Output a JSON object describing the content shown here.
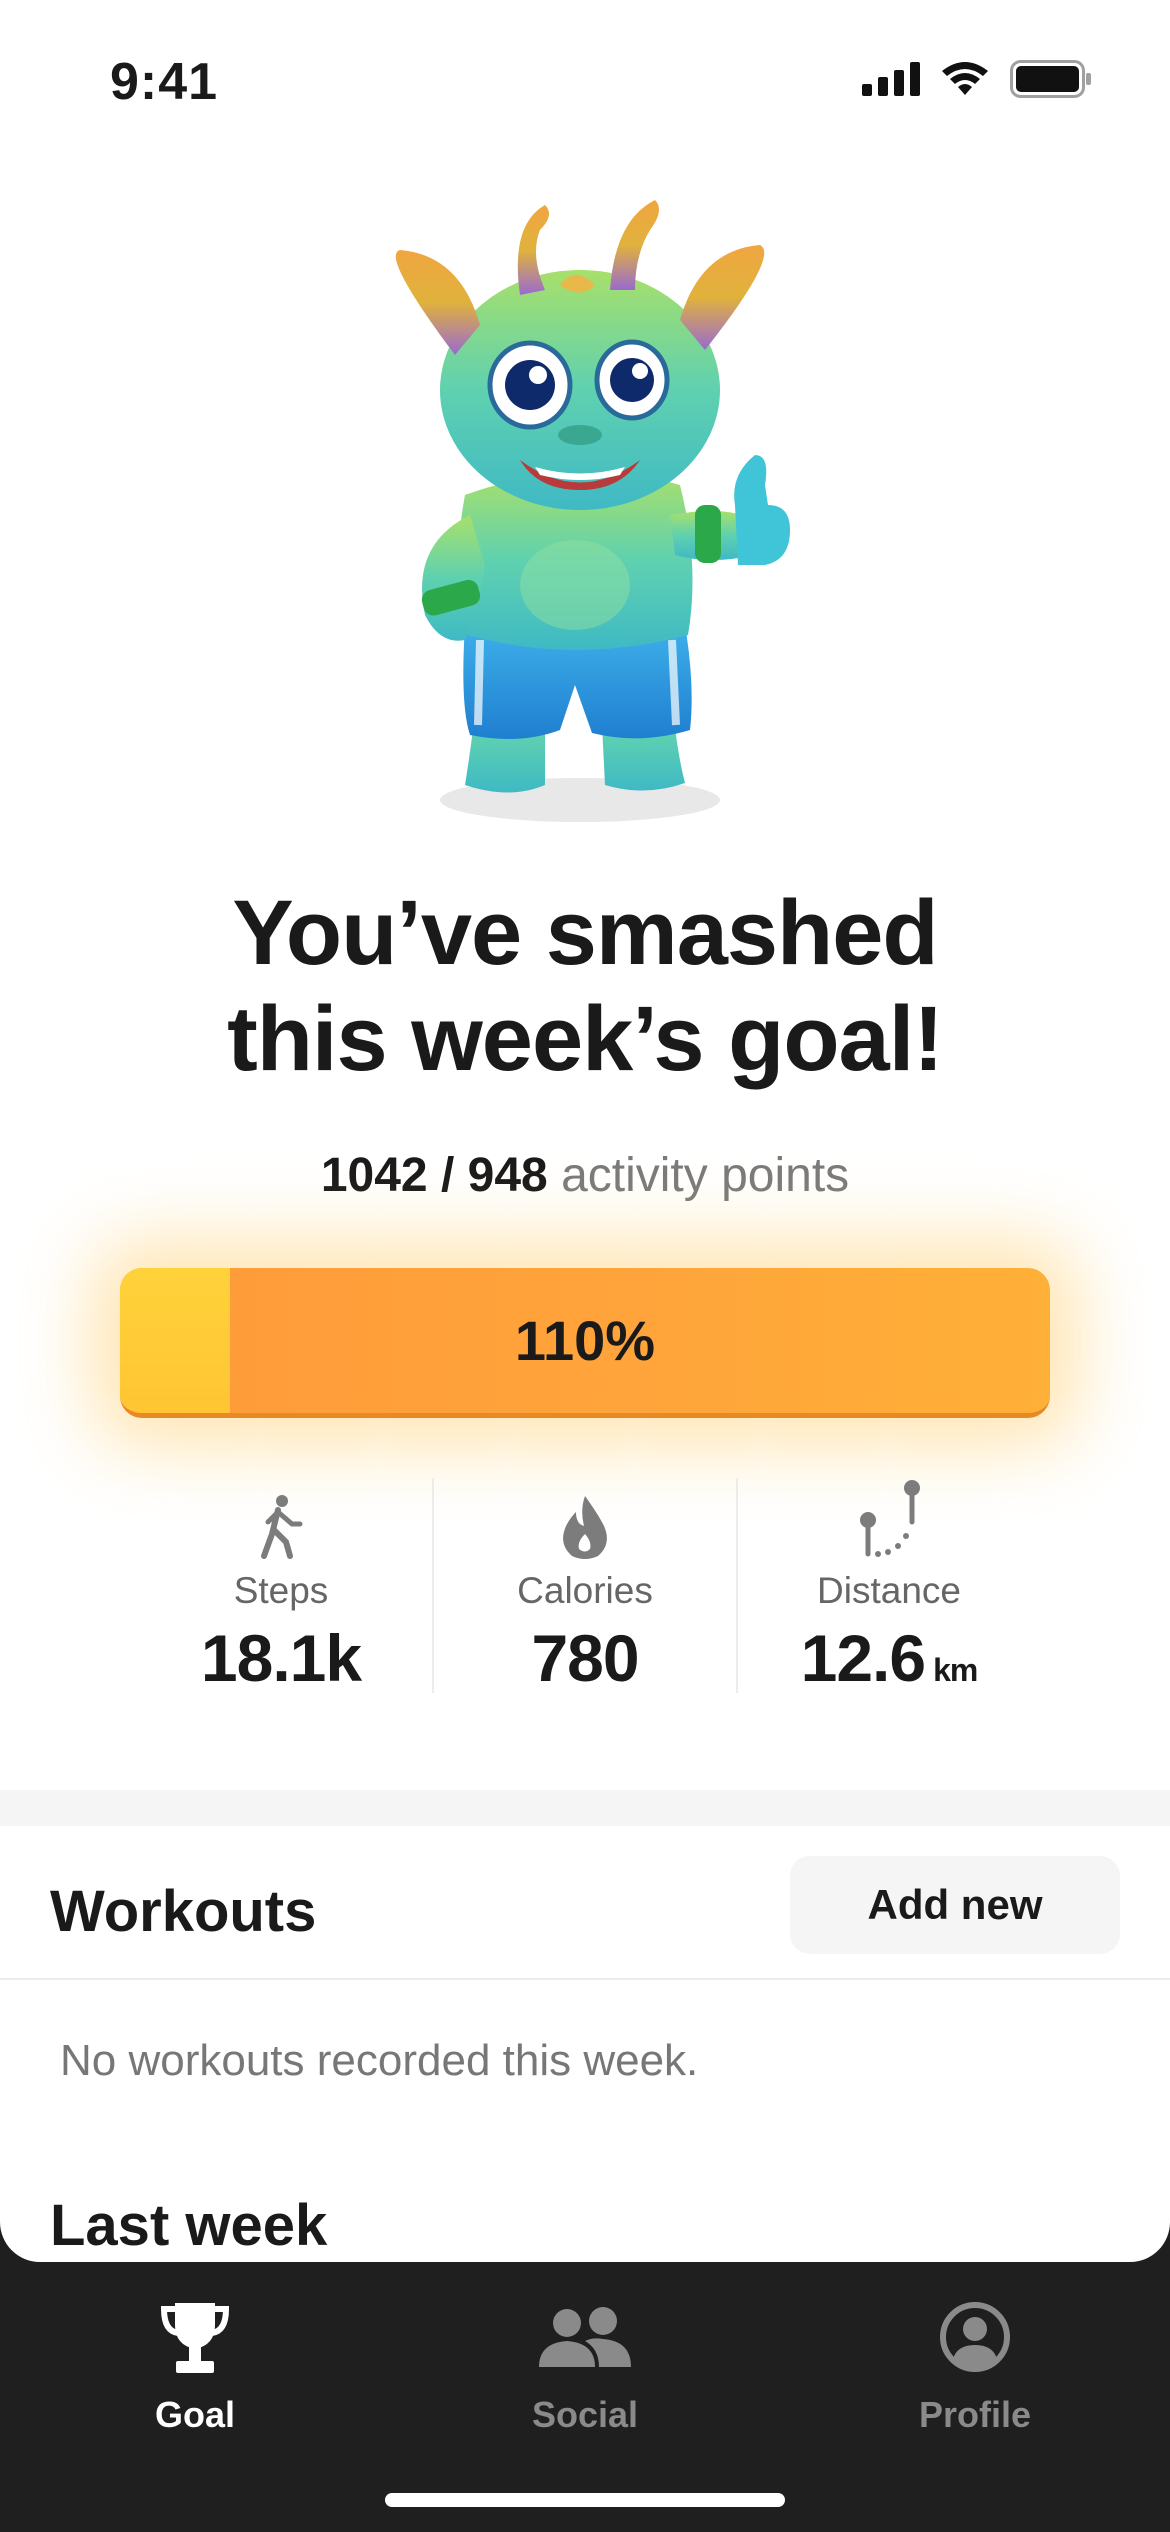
{
  "status_bar": {
    "time": "9:41"
  },
  "hero": {
    "headline_line1": "You’ve smashed",
    "headline_line2": "this week’s goal!"
  },
  "activity": {
    "current_points": "1042",
    "separator": "/",
    "goal_points": "948",
    "unit": "activity points",
    "progress_label": "110%",
    "progress_fraction": 1.1
  },
  "stats": [
    {
      "icon": "walking-person-icon",
      "label": "Steps",
      "value": "18.1k",
      "unit": ""
    },
    {
      "icon": "flame-icon",
      "label": "Calories",
      "value": "780",
      "unit": ""
    },
    {
      "icon": "route-distance-icon",
      "label": "Distance",
      "value": "12.6",
      "unit": "km"
    }
  ],
  "workouts": {
    "title": "Workouts",
    "add_label": "Add new",
    "empty_text": "No workouts recorded this week."
  },
  "last_week": {
    "title": "Last week"
  },
  "tab_bar": {
    "tabs": [
      {
        "label": "Goal",
        "icon": "trophy-icon",
        "active": true
      },
      {
        "label": "Social",
        "icon": "people-icon",
        "active": false
      },
      {
        "label": "Profile",
        "icon": "profile-icon",
        "active": false
      }
    ]
  },
  "colors": {
    "progress_start": "#ffd23a",
    "progress_fill": "#ffa53a",
    "tab_bar_bg": "#1f1f1f",
    "mascot_skin": "#5fd1b0",
    "mascot_shorts": "#2f9ee0"
  }
}
